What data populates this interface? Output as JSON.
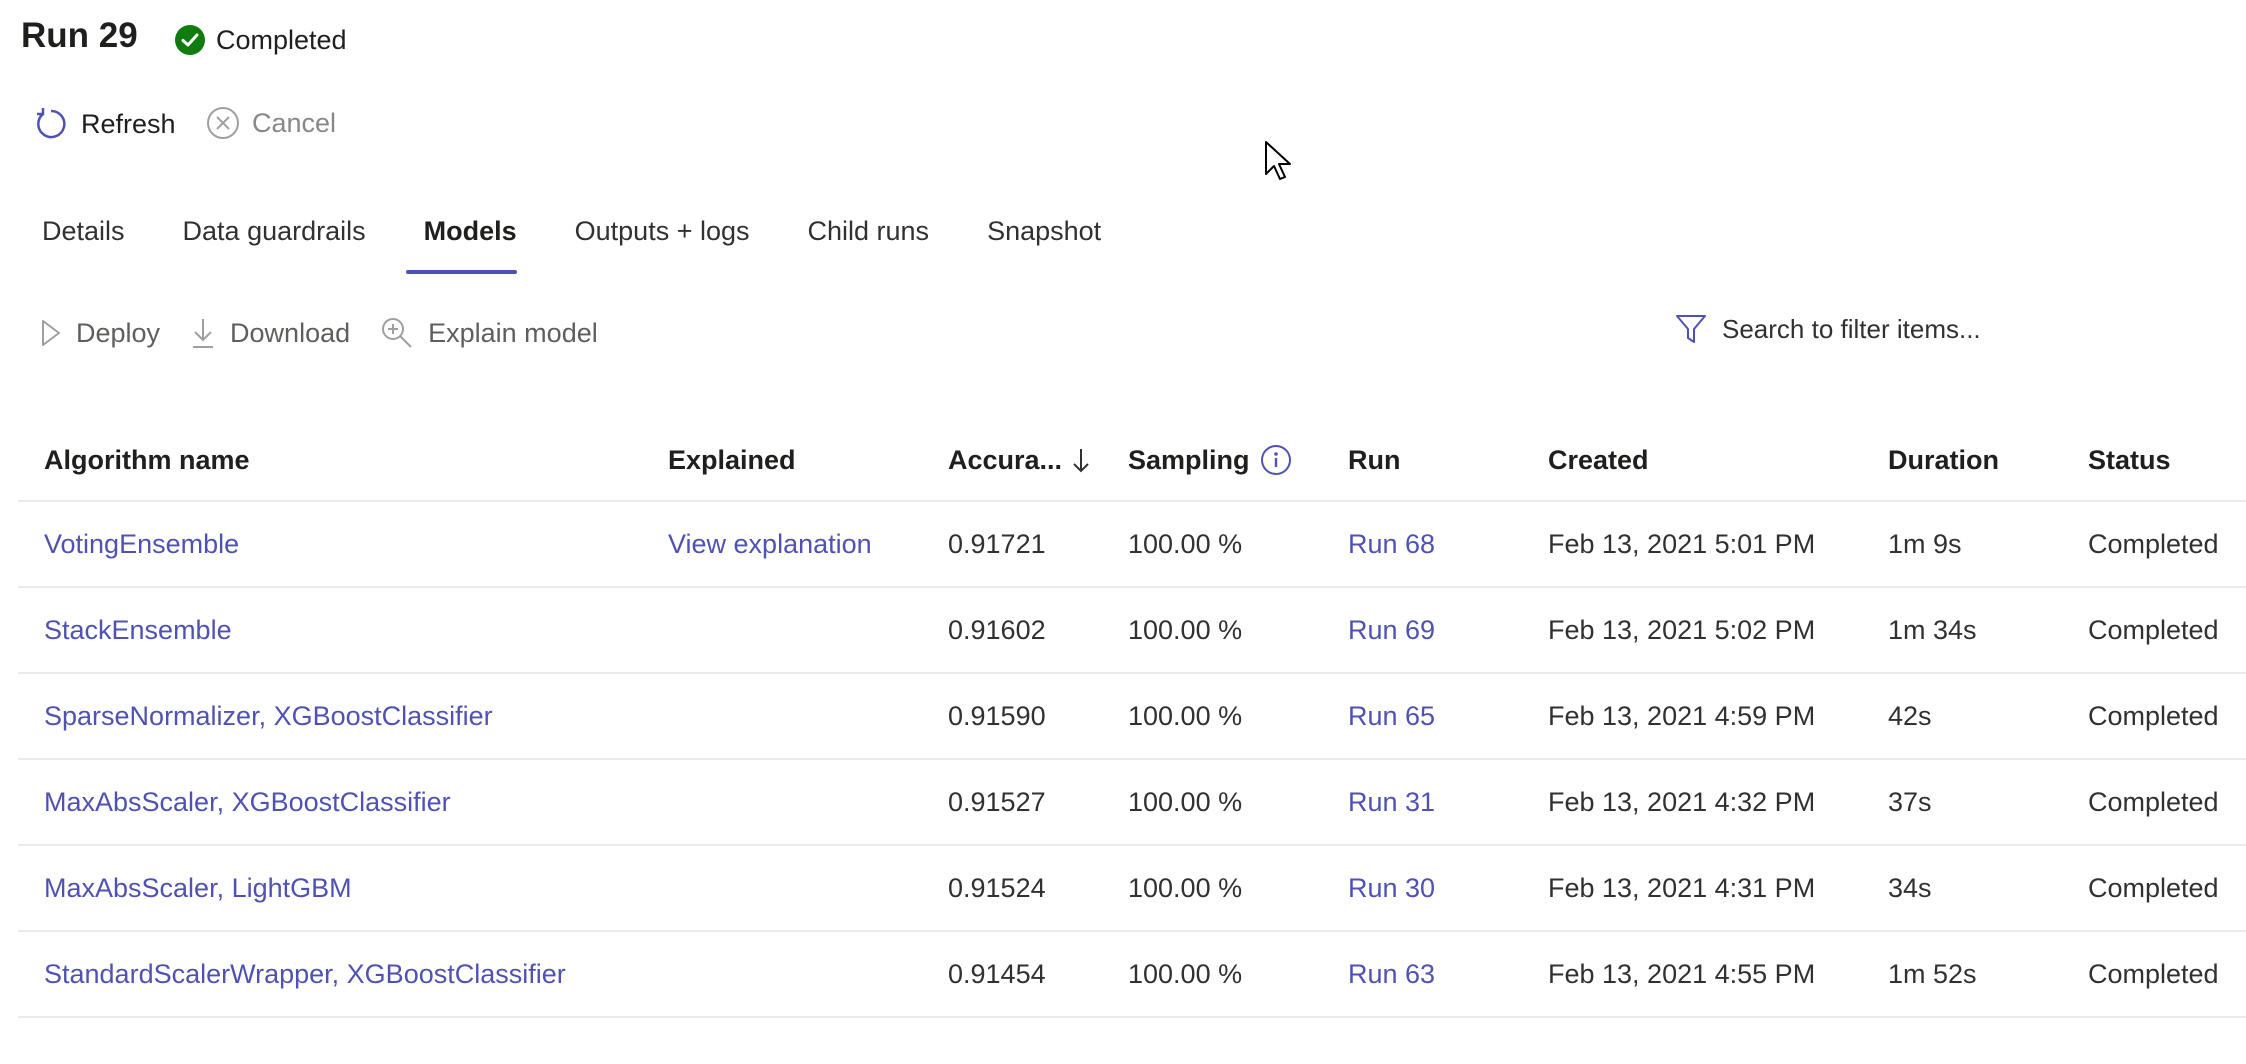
{
  "header": {
    "title": "Run 29",
    "status": "Completed"
  },
  "commands": {
    "refresh": "Refresh",
    "cancel": "Cancel"
  },
  "tabs": [
    {
      "label": "Details"
    },
    {
      "label": "Data guardrails"
    },
    {
      "label": "Models",
      "active": true
    },
    {
      "label": "Outputs + logs"
    },
    {
      "label": "Child runs"
    },
    {
      "label": "Snapshot"
    }
  ],
  "toolbar": {
    "deploy": "Deploy",
    "download": "Download",
    "explain": "Explain model",
    "search_placeholder": "Search to filter items..."
  },
  "table": {
    "columns": [
      "Algorithm name",
      "Explained",
      "Accura...",
      "Sampling",
      "Run",
      "Created",
      "Duration",
      "Status"
    ],
    "rows": [
      {
        "algorithm": "VotingEnsemble",
        "explained": "View explanation",
        "accuracy": "0.91721",
        "sampling": "100.00 %",
        "run": "Run 68",
        "created": "Feb 13, 2021 5:01 PM",
        "duration": "1m 9s",
        "status": "Completed"
      },
      {
        "algorithm": "StackEnsemble",
        "explained": "",
        "accuracy": "0.91602",
        "sampling": "100.00 %",
        "run": "Run 69",
        "created": "Feb 13, 2021 5:02 PM",
        "duration": "1m 34s",
        "status": "Completed"
      },
      {
        "algorithm": "SparseNormalizer, XGBoostClassifier",
        "explained": "",
        "accuracy": "0.91590",
        "sampling": "100.00 %",
        "run": "Run 65",
        "created": "Feb 13, 2021 4:59 PM",
        "duration": "42s",
        "status": "Completed"
      },
      {
        "algorithm": "MaxAbsScaler, XGBoostClassifier",
        "explained": "",
        "accuracy": "0.91527",
        "sampling": "100.00 %",
        "run": "Run 31",
        "created": "Feb 13, 2021 4:32 PM",
        "duration": "37s",
        "status": "Completed"
      },
      {
        "algorithm": "MaxAbsScaler, LightGBM",
        "explained": "",
        "accuracy": "0.91524",
        "sampling": "100.00 %",
        "run": "Run 30",
        "created": "Feb 13, 2021 4:31 PM",
        "duration": "34s",
        "status": "Completed"
      },
      {
        "algorithm": "StandardScalerWrapper, XGBoostClassifier",
        "explained": "",
        "accuracy": "0.91454",
        "sampling": "100.00 %",
        "run": "Run 63",
        "created": "Feb 13, 2021 4:55 PM",
        "duration": "1m 52s",
        "status": "Completed"
      }
    ]
  },
  "colors": {
    "accent": "#4f52b2",
    "success": "#107c10",
    "divider": "#edebe9"
  }
}
